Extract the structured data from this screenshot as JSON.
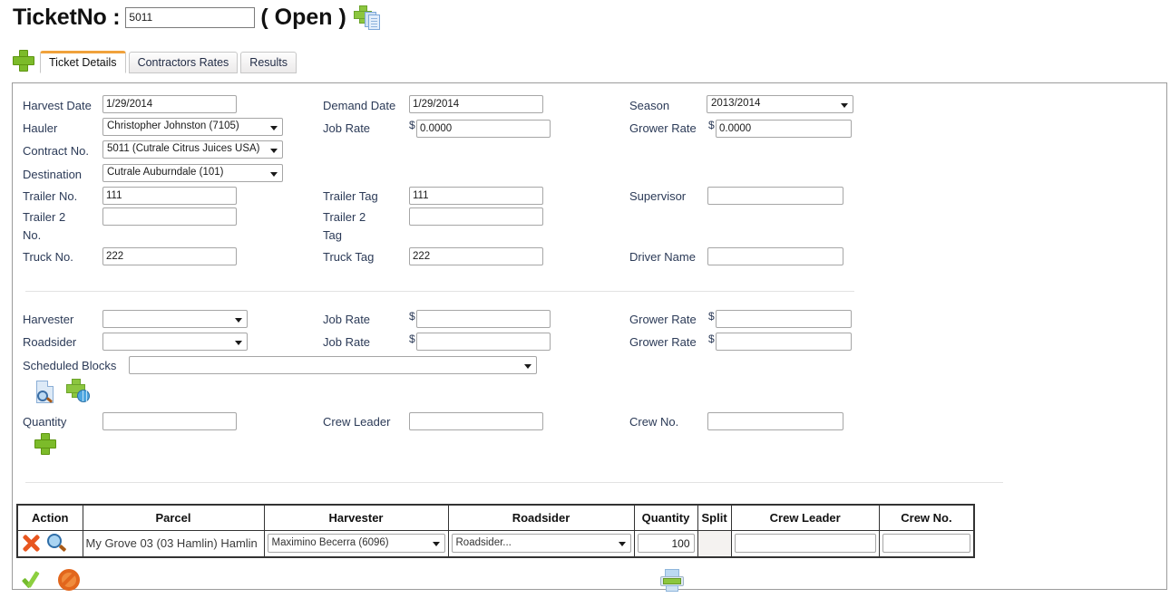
{
  "header": {
    "title": "TicketNo :",
    "ticket_no": "5011",
    "status": "( Open )",
    "add_doc_icon": "add-document-icon"
  },
  "tabs": {
    "add_icon": "add-icon",
    "items": [
      {
        "label": "Ticket Details",
        "active": true
      },
      {
        "label": "Contractors Rates",
        "active": false
      },
      {
        "label": "Results",
        "active": false
      }
    ]
  },
  "form": {
    "harvest_date": {
      "label": "Harvest Date",
      "value": "1/29/2014"
    },
    "demand_date": {
      "label": "Demand Date",
      "value": "1/29/2014"
    },
    "season": {
      "label": "Season",
      "value": "2013/2014"
    },
    "hauler": {
      "label": "Hauler",
      "value": "Christopher Johnston (7105)"
    },
    "job_rate_1": {
      "label": "Job Rate",
      "currency": "$",
      "value": "0.0000"
    },
    "grower_rate_1": {
      "label": "Grower Rate",
      "currency": "$",
      "value": "0.0000"
    },
    "contract_no": {
      "label": "Contract No.",
      "value": "5011 (Cutrale Citrus Juices USA)"
    },
    "destination": {
      "label": "Destination",
      "value": "Cutrale Auburndale (101)"
    },
    "trailer_no": {
      "label": "Trailer No.",
      "value": "111"
    },
    "trailer_tag": {
      "label": "Trailer Tag",
      "value": "111"
    },
    "supervisor": {
      "label": "Supervisor",
      "value": ""
    },
    "trailer2_no": {
      "label": "Trailer 2 No.",
      "label_line1": "Trailer 2",
      "label_line2": "No.",
      "value": ""
    },
    "trailer2_tag": {
      "label": "Trailer 2 Tag",
      "label_line1": "Trailer 2",
      "label_line2": "Tag",
      "value": ""
    },
    "truck_no": {
      "label": "Truck No.",
      "value": "222"
    },
    "truck_tag": {
      "label": "Truck Tag",
      "value": "222"
    },
    "driver_name": {
      "label": "Driver Name",
      "value": ""
    },
    "harvester": {
      "label": "Harvester",
      "value": ""
    },
    "job_rate_2": {
      "label": "Job Rate",
      "currency": "$",
      "value": ""
    },
    "grower_rate_2": {
      "label": "Grower Rate",
      "currency": "$",
      "value": ""
    },
    "roadsider": {
      "label": "Roadsider",
      "value": ""
    },
    "job_rate_3": {
      "label": "Job Rate",
      "currency": "$",
      "value": ""
    },
    "grower_rate_3": {
      "label": "Grower Rate",
      "currency": "$",
      "value": ""
    },
    "scheduled_blocks": {
      "label": "Scheduled Blocks",
      "value": ""
    },
    "quantity": {
      "label": "Quantity",
      "value": ""
    },
    "crew_leader": {
      "label": "Crew Leader",
      "value": ""
    },
    "crew_no": {
      "label": "Crew No.",
      "value": ""
    },
    "doc_search_icon": "document-search-icon",
    "add_block_icon": "add-block-icon",
    "add_row_icon": "add-row-icon"
  },
  "grid": {
    "columns": [
      "Action",
      "Parcel",
      "Harvester",
      "Roadsider",
      "Quantity",
      "Split",
      "Crew Leader",
      "Crew No."
    ],
    "rows": [
      {
        "delete_icon": "delete-icon",
        "view_icon": "view-icon",
        "parcel": "My Grove 03 (03 Hamlin) Hamlin",
        "harvester": "Maximino Becerra (6096)",
        "roadsider": "Roadsider...",
        "quantity": "100",
        "split": "",
        "crew_leader": "",
        "crew_no": ""
      }
    ]
  },
  "footer": {
    "save_icon": "confirm-icon",
    "cancel_icon": "cancel-icon",
    "print_icon": "print-icon"
  }
}
